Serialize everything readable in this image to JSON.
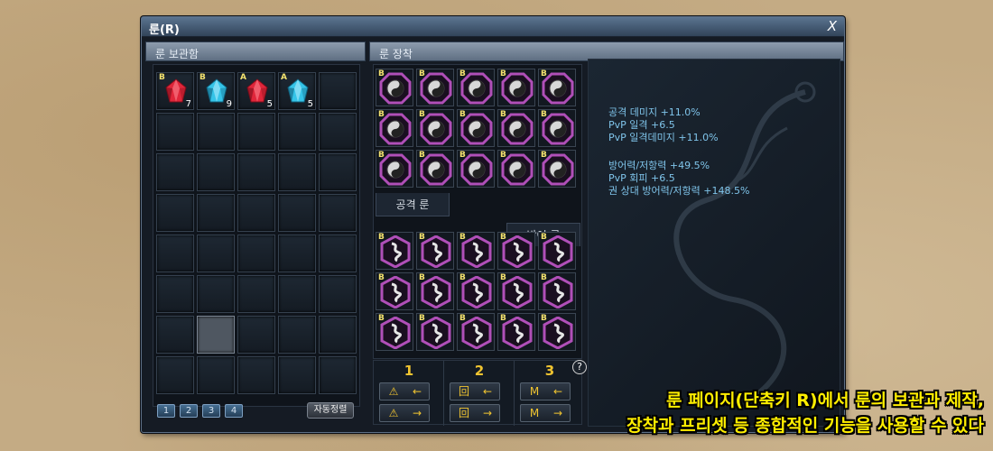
{
  "window": {
    "title": "룬(R)",
    "close_label": "X"
  },
  "storage": {
    "header": "룬 보관함",
    "slots": [
      {
        "grade": "B",
        "gem": "red",
        "count": "7"
      },
      {
        "grade": "B",
        "gem": "blue",
        "count": "9"
      },
      {
        "grade": "A",
        "gem": "red",
        "count": "5"
      },
      {
        "grade": "A",
        "gem": "blue",
        "count": "5"
      }
    ],
    "pages": [
      "1",
      "2",
      "3",
      "4"
    ],
    "sort_label": "자동정렬"
  },
  "equip": {
    "header": "룬 장착",
    "attack_tab": "공격 룬",
    "defense_tab": "방어 룬",
    "attack_rune_grade": "B",
    "defense_rune_grade": "B"
  },
  "presets": {
    "labels": [
      "1",
      "2",
      "3"
    ],
    "help_label": "?"
  },
  "stats": {
    "lines": [
      "공격 데미지 +11.0%",
      "PvP 일격 +6.5",
      "PvP 일격데미지 +11.0%",
      "방어력/저항력 +49.5%",
      "PvP 회피 +6.5",
      "권 상대 방어력/저항력 +148.5%"
    ]
  },
  "caption": {
    "line1": "룬 페이지(단축키 R)에서 룬의 보관과 제작,",
    "line2": "장착과 프리셋 등 종합적인 기능을 사용할 수 있다"
  },
  "colors": {
    "accent_yellow": "#f0c430",
    "stat_text": "#7fc4ea",
    "gem_red": "#e0263a",
    "gem_blue": "#35c4e8",
    "rune_frame": "#b04fb8"
  }
}
